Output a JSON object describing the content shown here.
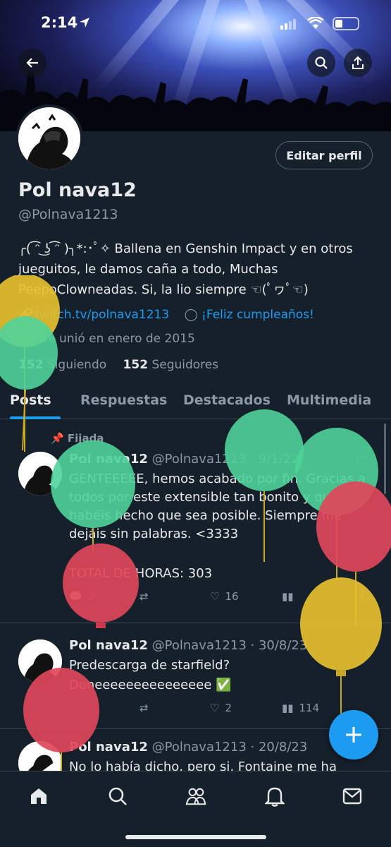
{
  "status": {
    "time": "2:14"
  },
  "profile": {
    "name": "Pol nava12",
    "handle": "@Polnava1213",
    "edit_label": "Editar perfil",
    "bio": "╭( ͡ᵔ ͜ʖ ͡ᵔ )╮*:･ﾟ✧ Ballena en Genshin Impact y en otros jueguitos, le damos caña a todo, Muchas PeepoClowneadas. Si, la lio siempre ☜(ﾟヮﾟ☜)",
    "link": "twitch.tv/polnava1213",
    "birthday": "¡Feliz cumpleaños!",
    "joined": "Se unió en enero de 2015",
    "following_count": "152",
    "following_label": "Siguiendo",
    "followers_count": "152",
    "followers_label": "Seguidores"
  },
  "tabs": [
    "Posts",
    "Respuestas",
    "Destacados",
    "Multimedia"
  ],
  "posts": [
    {
      "pinned_label": "Fijada",
      "name": "Pol nava12",
      "meta": "@Polnava1213 · 9/1/22",
      "text": "GENTEEEEE, hemos acabado por fin. Gracias a todos por este extensible tan bonito y que habéis hecho que sea posible. Siempre me dejáis sin palabras. <3333",
      "text2": "TOTAL DE HORAS: 303",
      "replies": "2",
      "likes": "16"
    },
    {
      "name": "Pol nava12",
      "meta": "@Polnava1213 · 30/8/23",
      "text": "Predescarga de starfield?",
      "text2": "Doneeeeeeeeeeeeeee ✅",
      "likes": "2",
      "views": "114"
    },
    {
      "name": "Pol nava12",
      "meta": "@Polnava1213 · 20/8/23",
      "text": "No lo había dicho, pero si, Fontaine me ha"
    }
  ],
  "colors": {
    "accent": "#1d9bf0",
    "background": "#15202b",
    "balloon_green": "#4fd39a",
    "balloon_red": "#e0475a",
    "balloon_yellow": "#e6c02f"
  }
}
